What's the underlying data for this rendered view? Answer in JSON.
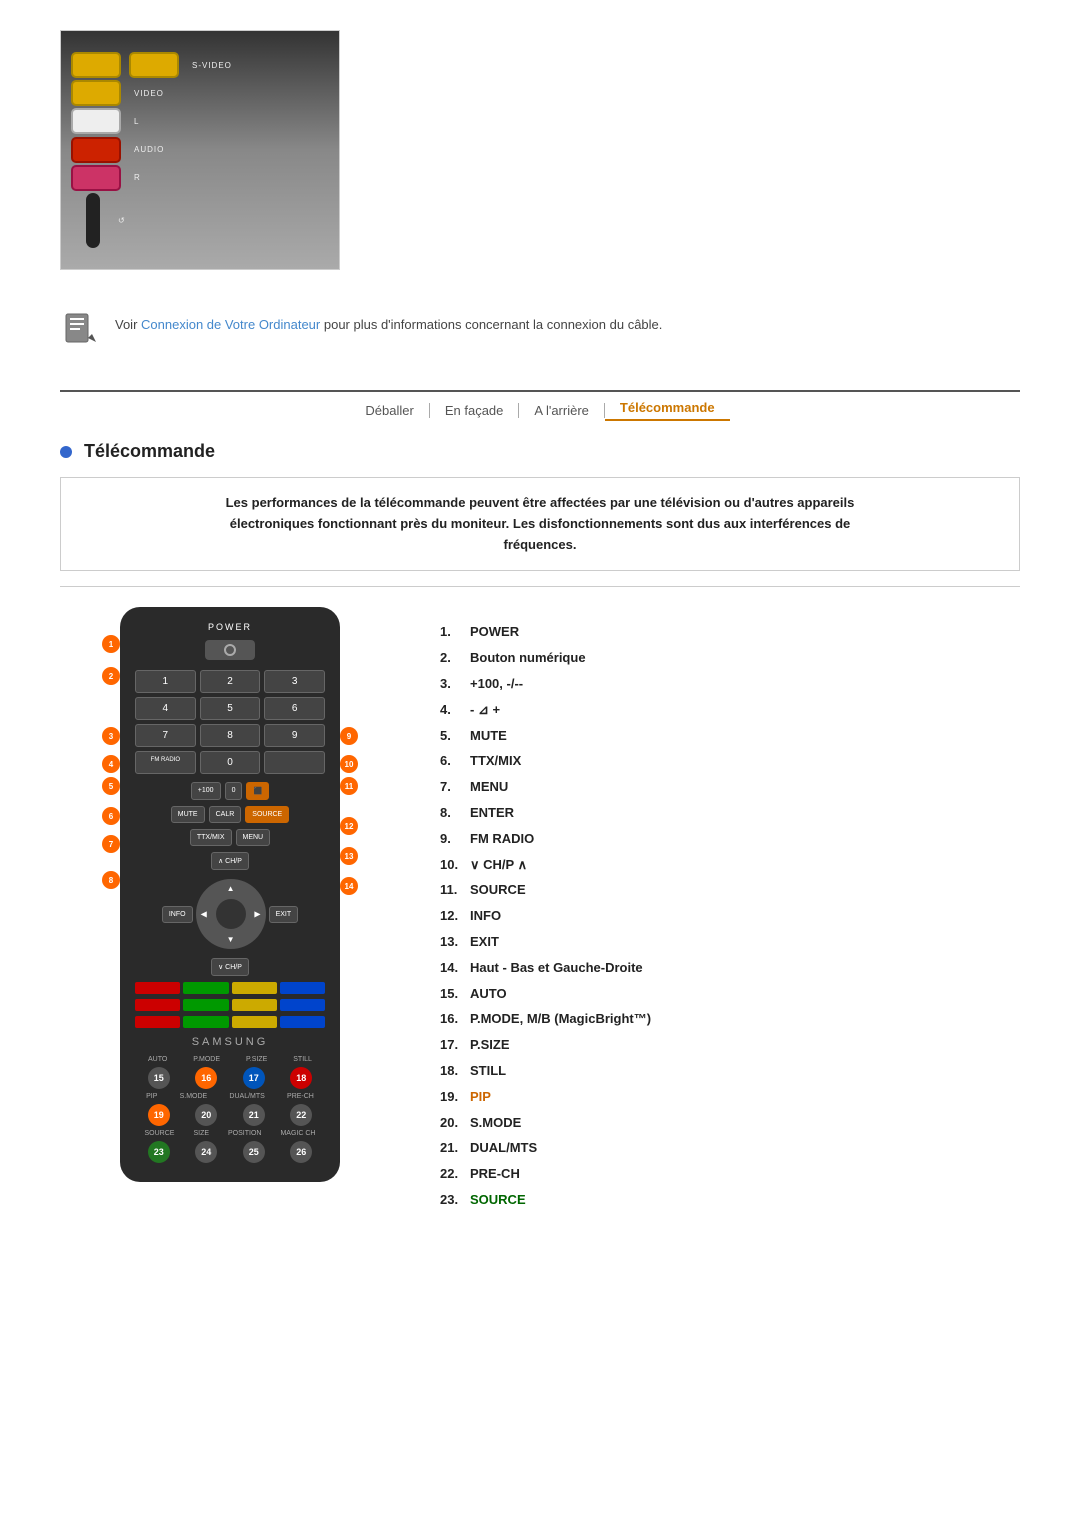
{
  "page": {
    "title": "Télécommande"
  },
  "top_image": {
    "alt": "Connecteurs audio/vidéo",
    "labels": [
      "S-VIDEO",
      "VIDEO",
      "L AUDIO R"
    ]
  },
  "note": {
    "prefix": "Voir ",
    "link_text": "Connexion de Votre Ordinateur",
    "suffix": " pour plus d'informations concernant la connexion du câble."
  },
  "breadcrumb": {
    "items": [
      {
        "label": "Déballer",
        "active": false
      },
      {
        "label": "En façade",
        "active": false
      },
      {
        "label": "A l'arrière",
        "active": false
      },
      {
        "label": "Télécommande",
        "active": true
      }
    ]
  },
  "warning": {
    "text": "Les performances de la télécommande peuvent être affectées par une télévision ou d'autres appareils\nélectroniques fonctionnant près du moniteur. Les disfonctionnements sont dus aux interférences de\nfréquences."
  },
  "features": [
    {
      "num": "1.",
      "label": "POWER",
      "style": "normal"
    },
    {
      "num": "2.",
      "label": "Bouton numérique",
      "style": "normal"
    },
    {
      "num": "3.",
      "label": "+100, -/--",
      "style": "normal"
    },
    {
      "num": "4.",
      "label": "- ⊿ +",
      "style": "normal"
    },
    {
      "num": "5.",
      "label": "MUTE",
      "style": "normal"
    },
    {
      "num": "6.",
      "label": "TTX/MIX",
      "style": "normal"
    },
    {
      "num": "7.",
      "label": "MENU",
      "style": "normal"
    },
    {
      "num": "8.",
      "label": "ENTER",
      "style": "normal"
    },
    {
      "num": "9.",
      "label": "FM RADIO",
      "style": "normal"
    },
    {
      "num": "10.",
      "label": "∨ CH/P ∧",
      "style": "normal"
    },
    {
      "num": "11.",
      "label": "SOURCE",
      "style": "normal"
    },
    {
      "num": "12.",
      "label": "INFO",
      "style": "normal"
    },
    {
      "num": "13.",
      "label": "EXIT",
      "style": "normal"
    },
    {
      "num": "14.",
      "label": "Haut - Bas et Gauche-Droite",
      "style": "normal"
    },
    {
      "num": "15.",
      "label": "AUTO",
      "style": "normal"
    },
    {
      "num": "16.",
      "label": "P.MODE, M/B (MagicBright™)",
      "style": "normal"
    },
    {
      "num": "17.",
      "label": "P.SIZE",
      "style": "normal"
    },
    {
      "num": "18.",
      "label": "STILL",
      "style": "normal"
    },
    {
      "num": "19.",
      "label": "PIP",
      "style": "orange"
    },
    {
      "num": "20.",
      "label": "S.MODE",
      "style": "normal"
    },
    {
      "num": "21.",
      "label": "DUAL/MTS",
      "style": "normal"
    },
    {
      "num": "22.",
      "label": "PRE-CH",
      "style": "normal"
    },
    {
      "num": "23.",
      "label": "SOURCE",
      "style": "green"
    }
  ],
  "remote": {
    "brand": "SAMSUNG",
    "power_label": "POWER",
    "numbers": [
      "1",
      "2",
      "3",
      "4",
      "5",
      "6",
      "7",
      "8",
      "9",
      "FM RADIO",
      "0",
      ""
    ],
    "buttons": {
      "plus100": "+100",
      "minus": "-/--",
      "mute": "MUTE",
      "ttx": "TTX/MIX",
      "calr": "CALR",
      "source": "SOURCE",
      "menu": "MENU",
      "enter": "ENTER",
      "ch_up": "∧",
      "ch_down": "∨",
      "info": "INFO",
      "exit": "EXIT",
      "auto_label": "AUTO",
      "pmode": "P.MODE",
      "psize": "P.SIZE",
      "still": "STILL",
      "pip": "PIP",
      "smode": "S.MODE",
      "dual": "DUAL/MTS",
      "prech": "PRE-CH",
      "source2": "SOURCE",
      "size": "SIZE",
      "position": "POSITION",
      "magicch": "MAGIC CH"
    },
    "bottom_row1_labels": [
      "AUTO",
      "P.MODE",
      "P.SIZE",
      "STILL"
    ],
    "bottom_row2_labels": [
      "PIP",
      "S.MODE",
      "DUAL/MTS",
      "PRE-CH"
    ],
    "bottom_row3_labels": [
      "SOURCE",
      "SIZE",
      "POSITION",
      "MAGIC CH"
    ]
  }
}
